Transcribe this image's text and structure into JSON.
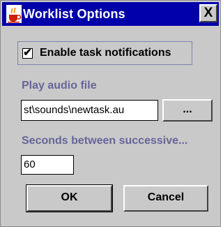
{
  "window": {
    "title": "Worklist Options",
    "close_glyph": "X",
    "app_icon": "java-cup-icon"
  },
  "notifications": {
    "checked": true,
    "check_glyph": "✔",
    "label": "Enable task notifications"
  },
  "audio": {
    "label": "Play audio file",
    "value": "st\\sounds\\newtask.au",
    "browse_label": "..."
  },
  "seconds": {
    "label": "Seconds between successive...",
    "value": "60"
  },
  "buttons": {
    "ok": "OK",
    "cancel": "Cancel"
  },
  "colors": {
    "titlebar": "#0000aa",
    "dialog_bg": "#c9c9c9",
    "section_label": "#66669a"
  }
}
